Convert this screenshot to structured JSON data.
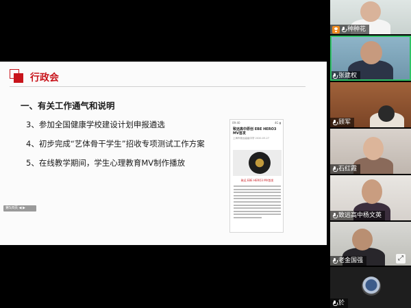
{
  "slide": {
    "title": "行政会",
    "heading": "一、有关工作通气和说明",
    "bullets": [
      "3、参加全国健康学校建设计划申报遴选",
      "4、初步完成“艺体骨干学生”招收专项测试工作方案",
      "5、在线教学期间，学生心理教育MV制作播放"
    ],
    "pager_text": "第5/8页 ◀ ▶"
  },
  "phone": {
    "status_left": "09:40",
    "status_right": "4G ▮",
    "title": "致远高中原创 EBE HERO3 MV首发",
    "meta": "上海市致远高级中学 2020-03-27",
    "caption": "致远 EBE HERO3 MV首发"
  },
  "participants": [
    {
      "name": "种种花",
      "host": true,
      "active": false
    },
    {
      "name": "张建权",
      "host": false,
      "active": true
    },
    {
      "name": "顾军",
      "host": false,
      "active": false
    },
    {
      "name": "石红霞",
      "host": false,
      "active": false
    },
    {
      "name": "致远高中杨文英",
      "host": false,
      "active": false
    },
    {
      "name": "老金国强",
      "host": false,
      "active": false
    },
    {
      "name": "於",
      "host": false,
      "active": false
    }
  ],
  "colors": {
    "accent_red": "#c8141b",
    "active_speaker": "#30c266",
    "host_badge": "#f08a1e"
  },
  "icons": {
    "mic": "mic-icon",
    "host": "host-badge-icon",
    "expand": "expand-icon"
  }
}
